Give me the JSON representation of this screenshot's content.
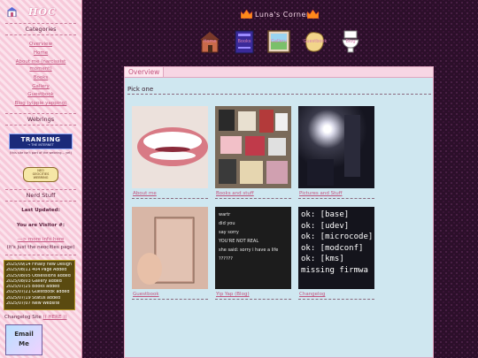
{
  "sidebar": {
    "logo_text": "HOC",
    "categories_title": "Categories",
    "nav_links": [
      {
        "label": "Overview"
      },
      {
        "label": "Home"
      },
      {
        "label": "About me (narcissist"
      },
      {
        "label": "moment)"
      },
      {
        "label": "Books"
      },
      {
        "label": "Gallery"
      },
      {
        "label": "Guestbook"
      },
      {
        "label": "Blog (yippie yapping)"
      }
    ],
    "webrings_title": "Webrings",
    "badge1_line1": "TRANSING",
    "badge1_line2": "→ THE INTERNET",
    "badge_note": "(this site isn't part of the webring... yet)",
    "badge2_line1": "NEO",
    "badge2_line2": "GEOCITIES",
    "badge2_line3": "WEBRING",
    "nerd_title": "Nerd Stuff",
    "last_updated_label": "Last Updated:",
    "visitor_label": "You are Visitor #:",
    "more_info_link": "---> more info here",
    "more_info_note": "(it's just the neocities page)",
    "changelog": [
      "2025/09/14 Finally new Design",
      "2025/08/11 404 Page Added",
      "2025/08/05 Obsessions added",
      "2025/08/03 Gallery added",
      "2025/07/25 Books added",
      "2025/07/21 Guestbook added",
      "2025/07/19 Status added",
      "2025/07/07 New Website"
    ],
    "changelog_label": "Changelog Site",
    "changelog_link": "(( HERE ))",
    "email_line1": "Email",
    "email_line2": "Me"
  },
  "header": {
    "title": "Luna's Corner",
    "nav_icons": [
      {
        "label": "Home",
        "icon": "house-icon"
      },
      {
        "label": "Books",
        "icon": "book-icon"
      },
      {
        "label": "Gallery",
        "icon": "picture-frame-icon"
      },
      {
        "label": "Guestbook",
        "icon": "guestbook-icon"
      },
      {
        "label": "Blog",
        "icon": "toilet-icon"
      }
    ]
  },
  "panel": {
    "tab": "Overview",
    "heading": "Pick one",
    "cards": [
      {
        "caption": "About me"
      },
      {
        "caption": "Books and stuff"
      },
      {
        "caption": "Pictures and Stuff"
      },
      {
        "caption": "Guestbook"
      },
      {
        "caption": "Yip Yap (Blog)"
      },
      {
        "caption": "Changelog"
      }
    ],
    "chat_lines": [
      "wartr",
      "did you",
      "say sorry",
      "YOU'RE NOT REAL",
      "she said: sorry i have a life",
      "??????"
    ],
    "terminal_lines": [
      "ok: [base]",
      "ok: [udev]",
      "ok: [microcode]",
      "ok: [modconf]",
      "ok: [kms]",
      "  missing firmwa"
    ]
  },
  "colors": {
    "accent": "#c2557f",
    "panel_bg": "#cfe7f0",
    "sidebar_pink": "#fbe3ec",
    "main_bg": "#2c0f2a"
  }
}
